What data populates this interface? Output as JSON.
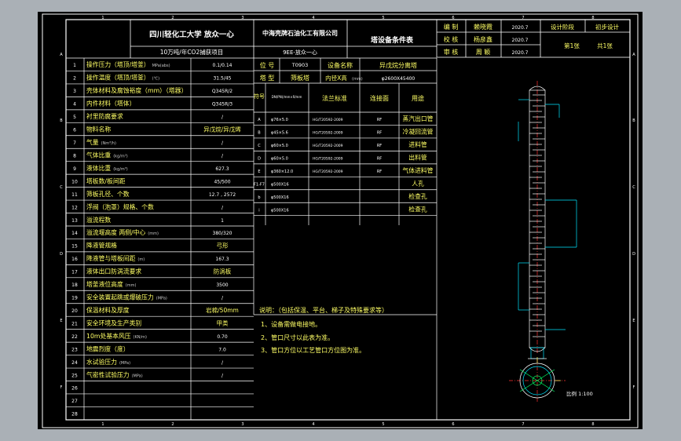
{
  "title_block": {
    "university": "四川轻化工大学  放众一心",
    "project": "10万吨/年CO2捕获项目",
    "company": "中海壳牌石油化工有限公司",
    "drawing_name": "9EE-放众一心",
    "sheet_title": "塔设备条件表",
    "roles": [
      {
        "role": "编  制",
        "name": "赖晓霞",
        "date": "2020.7"
      },
      {
        "role": "校  核",
        "name": "杨彦鑫",
        "date": "2020.7"
      },
      {
        "role": "审  核",
        "name": "周  颖",
        "date": "2020.7"
      }
    ],
    "stage_label": "设计阶段",
    "stage_value": "初步设计",
    "sheet_no": "第1张",
    "sheet_total": "共1张"
  },
  "params": [
    {
      "no": "1",
      "label": "操作压力（塔顶/塔釜）",
      "unit": "MPa(abs)",
      "value": "0.1/0.14"
    },
    {
      "no": "2",
      "label": "操作温度（塔顶/塔釜）",
      "unit": "(℃)",
      "value": "31.5/45"
    },
    {
      "no": "3",
      "label": "壳体材料及腐蚀裕度（mm）（塔器）",
      "unit": "",
      "value": "Q345R/2"
    },
    {
      "no": "4",
      "label": "内件材料（塔体）",
      "unit": "",
      "value": "Q345R/3"
    },
    {
      "no": "5",
      "label": "衬里防腐要求",
      "unit": "",
      "value": "/"
    },
    {
      "no": "6",
      "label": "物料名称",
      "unit": "",
      "value": "异戊烷/异戊烯"
    },
    {
      "no": "7",
      "label": "气量",
      "unit": "(Nm³/h)",
      "value": "/"
    },
    {
      "no": "8",
      "label": "气体比重",
      "unit": "(kg/m³)",
      "value": "/"
    },
    {
      "no": "9",
      "label": "液体比重",
      "unit": "(kg/m³)",
      "value": "627.3"
    },
    {
      "no": "10",
      "label": "塔板数/板间距",
      "unit": "",
      "value": "45/500"
    },
    {
      "no": "11",
      "label": "筛板孔径、个数",
      "unit": "",
      "value": "12.7 , 2572"
    },
    {
      "no": "12",
      "label": "浮阀（泡罩）规格、个数",
      "unit": "",
      "value": "/"
    },
    {
      "no": "13",
      "label": "溢流程数",
      "unit": "",
      "value": "1"
    },
    {
      "no": "14",
      "label": "溢流堰高度  两侧/中心",
      "unit": "(mm)",
      "value": "380/320"
    },
    {
      "no": "15",
      "label": "降液管规格",
      "unit": "",
      "value": "弓形"
    },
    {
      "no": "16",
      "label": "降液管与塔板间距",
      "unit": "(m)",
      "value": "167.3"
    },
    {
      "no": "17",
      "label": "液体出口防涡流要求",
      "unit": "",
      "value": "防涡板"
    },
    {
      "no": "18",
      "label": "塔釜液位高度",
      "unit": "(mm)",
      "value": "3500"
    },
    {
      "no": "19",
      "label": "安全装置起跳或爆破压力",
      "unit": "(MPa)",
      "value": "/"
    },
    {
      "no": "20",
      "label": "保温材料及厚度",
      "unit": "",
      "value": "岩棉/50mm"
    },
    {
      "no": "21",
      "label": "安全环境及生产类别",
      "unit": "",
      "value": "甲类"
    },
    {
      "no": "22",
      "label": "10m处基本风压",
      "unit": "(KN/m)",
      "value": "0.70"
    },
    {
      "no": "23",
      "label": "地震烈度（度）",
      "unit": "",
      "value": "7.0"
    },
    {
      "no": "24",
      "label": "水试验压力",
      "unit": "(MPa)",
      "value": "/"
    },
    {
      "no": "25",
      "label": "气密性试验压力",
      "unit": "(MPa)",
      "value": "/"
    },
    {
      "no": "26",
      "label": "",
      "unit": "",
      "value": ""
    },
    {
      "no": "27",
      "label": "",
      "unit": "",
      "value": ""
    },
    {
      "no": "28",
      "label": "",
      "unit": "",
      "value": ""
    }
  ],
  "equipment": {
    "tag_label": "位  号",
    "tag_value": "T0903",
    "name_label": "设备名称",
    "name_value": "异戊烷分离塔",
    "type_label": "塔  型",
    "type_value": "筛板塔",
    "dims_label": "内径X高",
    "dims_unit": "(mm)",
    "dims_value": "φ2600X45400"
  },
  "nozzle_headers": [
    "符号",
    "DN(PN)/mm×δ/mm",
    "法兰标准",
    "连接面",
    "用途"
  ],
  "nozzles": [
    {
      "sym": "A",
      "size": "φ76×5.0",
      "std": "HG/T20592-2009",
      "face": "RF",
      "use": "蒸汽出口管"
    },
    {
      "sym": "B",
      "size": "φ45×5.6",
      "std": "HG/T20592-2009",
      "face": "RF",
      "use": "冷凝回流管"
    },
    {
      "sym": "C",
      "size": "φ60×5.0",
      "std": "HG/T20592-2009",
      "face": "RF",
      "use": "进料管"
    },
    {
      "sym": "D",
      "size": "φ60×5.0",
      "std": "HG/T20592-2009",
      "face": "RF",
      "use": "出料管"
    },
    {
      "sym": "E",
      "size": "φ360×12.0",
      "std": "HG/T20592-2009",
      "face": "RF",
      "use": "气体进料管"
    },
    {
      "sym": "F1-F7",
      "size": "φ500X16",
      "std": "",
      "face": "",
      "use": "人孔"
    },
    {
      "sym": "b",
      "size": "φ500X16",
      "std": "",
      "face": "",
      "use": "检查孔"
    },
    {
      "sym": "i",
      "size": "φ500X16",
      "std": "",
      "face": "",
      "use": "检查孔"
    }
  ],
  "notes_title": "说明：（包括保温、平台、梯子及特殊要求等）",
  "notes": [
    "1、设备需做电接地。",
    "2、管口尺寸以此表为准。",
    "3、管口方位以工艺管口方位图为准。"
  ],
  "scale_text": "比例 1:100",
  "col_markers": [
    "1",
    "2",
    "3",
    "4",
    "5",
    "6",
    "7",
    "8"
  ],
  "row_markers": [
    "A",
    "B",
    "C",
    "D",
    "E",
    "F"
  ]
}
